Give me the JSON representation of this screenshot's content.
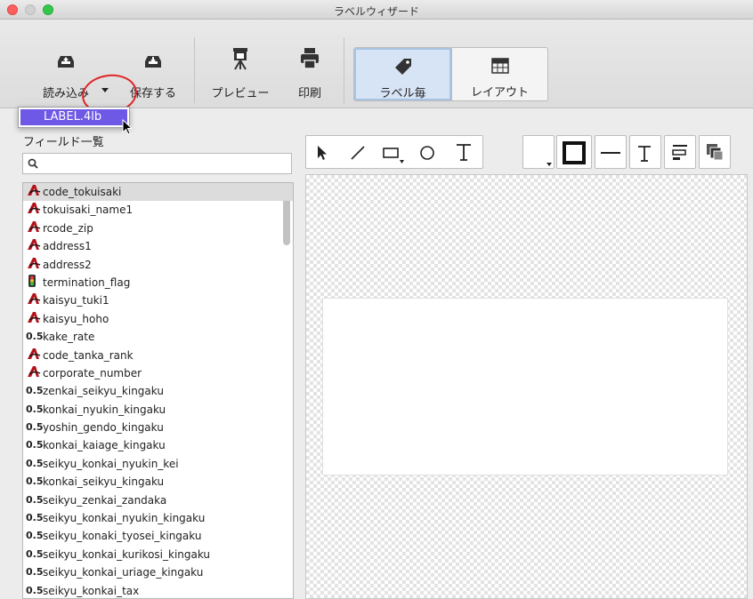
{
  "window": {
    "title": "ラベルウィザード"
  },
  "toolbar": {
    "load": "読み込み",
    "save": "保存する",
    "preview": "プレビュー",
    "print": "印刷",
    "per_label": "ラベル毎",
    "layout": "レイアウト"
  },
  "popup": {
    "item": "LABEL.4lb"
  },
  "field_panel": {
    "title": "フィールド一覧",
    "search_placeholder": ""
  },
  "fields": [
    {
      "name": "code_tokuisaki",
      "type": "text"
    },
    {
      "name": "tokuisaki_name1",
      "type": "text"
    },
    {
      "name": "rcode_zip",
      "type": "text"
    },
    {
      "name": "address1",
      "type": "text"
    },
    {
      "name": "address2",
      "type": "text"
    },
    {
      "name": "termination_flag",
      "type": "boolean"
    },
    {
      "name": "kaisyu_tuki1",
      "type": "text"
    },
    {
      "name": "kaisyu_hoho",
      "type": "text"
    },
    {
      "name": "kake_rate",
      "type": "number"
    },
    {
      "name": "code_tanka_rank",
      "type": "text"
    },
    {
      "name": "corporate_number",
      "type": "text"
    },
    {
      "name": "zenkai_seikyu_kingaku",
      "type": "number"
    },
    {
      "name": "konkai_nyukin_kingaku",
      "type": "number"
    },
    {
      "name": "yoshin_gendo_kingaku",
      "type": "number"
    },
    {
      "name": "konkai_kaiage_kingaku",
      "type": "number"
    },
    {
      "name": "seikyu_konkai_nyukin_kei",
      "type": "number"
    },
    {
      "name": "konkai_seikyu_kingaku",
      "type": "number"
    },
    {
      "name": "seikyu_zenkai_zandaka",
      "type": "number"
    },
    {
      "name": "seikyu_konkai_nyukin_kingaku",
      "type": "number"
    },
    {
      "name": "seikyu_konaki_tyosei_kingaku",
      "type": "number"
    },
    {
      "name": "seikyu_konkai_kurikosi_kingaku",
      "type": "number"
    },
    {
      "name": "seikyu_konkai_uriage_kingaku",
      "type": "number"
    },
    {
      "name": "seikyu_konkai_tax",
      "type": "number"
    }
  ],
  "type_icons": {
    "text": "A",
    "number": "0.5",
    "boolean": "toggle-icon"
  },
  "colors": {
    "text_icon": "#b3121b",
    "selection": "#6e58e6",
    "annotation": "#e0252a"
  }
}
